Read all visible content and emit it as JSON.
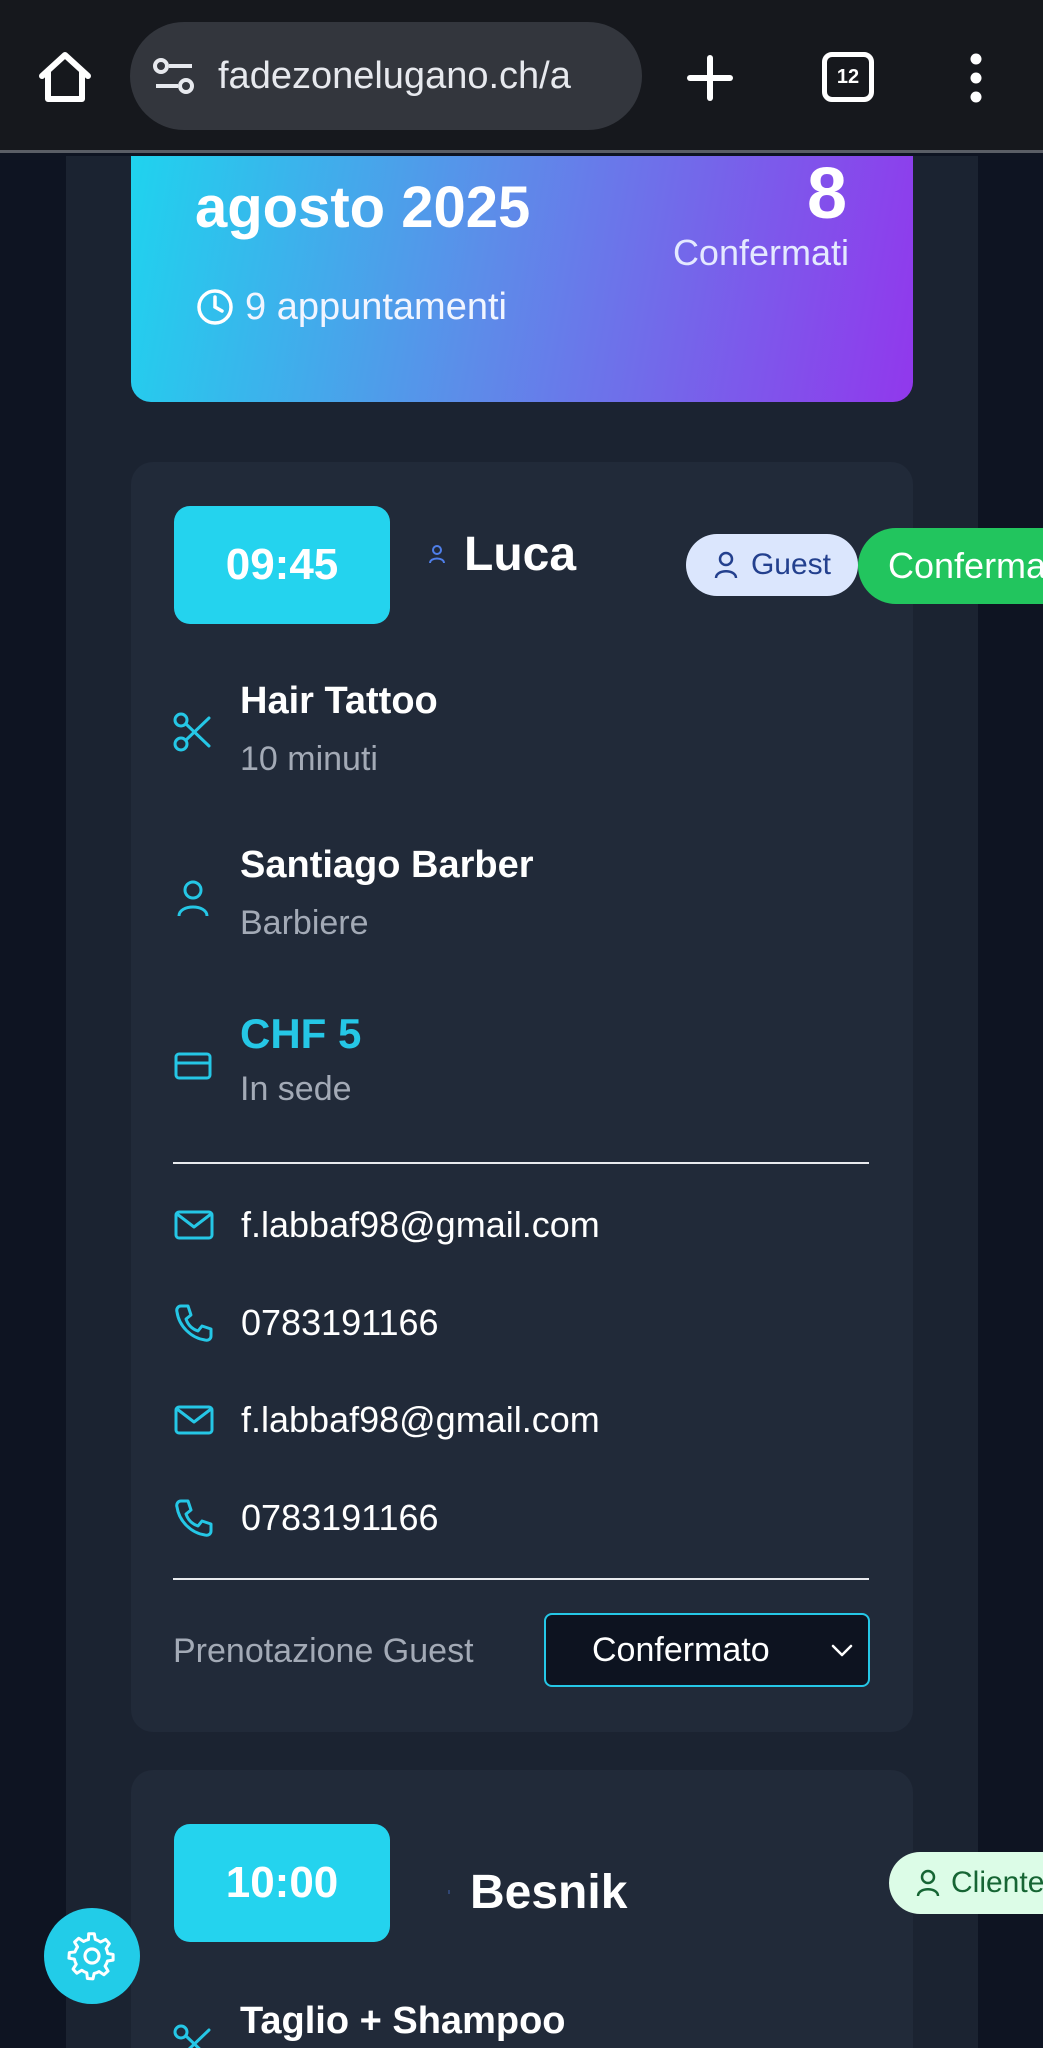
{
  "browser": {
    "url": "fadezonelugano.ch/a",
    "tab_count": "12"
  },
  "summary": {
    "month": "agosto 2025",
    "appointments": "9 appuntamenti",
    "confirmed_count": "8",
    "confirmed_label": "Confermati"
  },
  "appointment1": {
    "time": "09:45",
    "customer": "Luca",
    "type_badge": "Guest",
    "status_badge": "Confermato",
    "service": "Hair Tattoo",
    "duration": "10 minuti",
    "barber": "Santiago Barber",
    "barber_role": "Barbiere",
    "price": "CHF 5",
    "payment": "In sede",
    "contacts": [
      {
        "type": "email",
        "value": "f.labbaf98@gmail.com"
      },
      {
        "type": "phone",
        "value": "0783191166"
      },
      {
        "type": "email",
        "value": "f.labbaf98@gmail.com"
      },
      {
        "type": "phone",
        "value": "0783191166"
      }
    ],
    "footer_label": "Prenotazione Guest",
    "status_select": "Confermato"
  },
  "appointment2": {
    "time": "10:00",
    "customer": "Besnik",
    "type_badge": "Cliente",
    "service": "Taglio + Shampoo"
  },
  "colors": {
    "accent": "#24d3ee",
    "confirmed": "#22c55e",
    "card_bg": "#212a39",
    "page_bg": "#0e1422"
  }
}
